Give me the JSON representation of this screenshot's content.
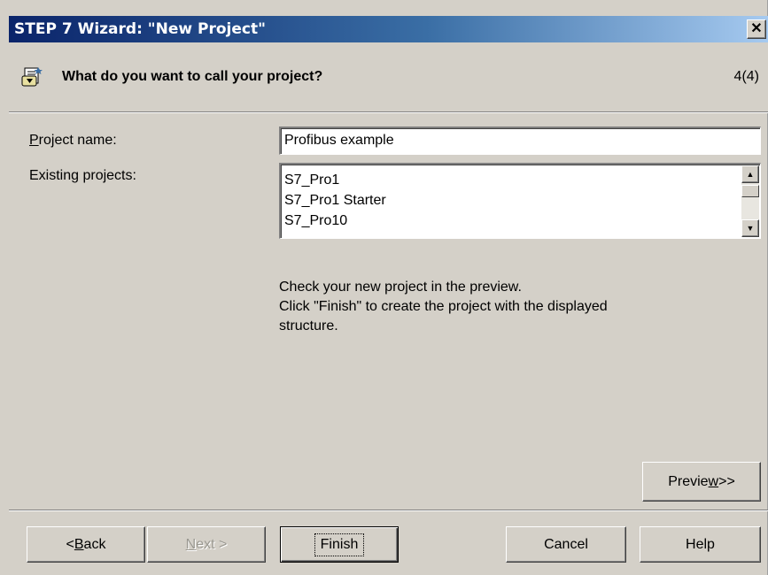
{
  "window": {
    "title": "STEP 7 Wizard: \"New Project\"",
    "close_glyph": "✕"
  },
  "header": {
    "icon": "wizard-icon",
    "question": "What do you want to call your project?",
    "step": "4(4)"
  },
  "form": {
    "project_name_label_first": "P",
    "project_name_label_rest": "roject name:",
    "project_name_value": "Profibus example",
    "existing_projects_label": "Existing projects:",
    "existing_projects": [
      "S7_Pro1",
      "S7_Pro1 Starter",
      "S7_Pro10"
    ]
  },
  "info": {
    "line1": "Check your new project in the preview.",
    "line2": "Click \"Finish\" to create the project with the displayed",
    "line3": "structure."
  },
  "buttons": {
    "preview_pre": "Previe",
    "preview_ul": "w",
    "preview_post": ">>",
    "back_pre": "< ",
    "back_ul": "B",
    "back_post": "ack",
    "next_ul": "N",
    "next_post": "ext >",
    "finish": "Finish",
    "cancel": "Cancel",
    "help": "Help"
  }
}
